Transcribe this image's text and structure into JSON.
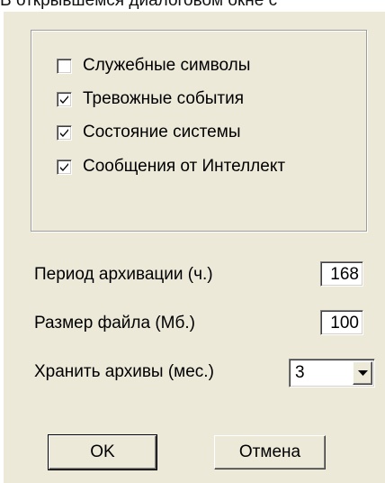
{
  "caption": "В открывшемся диалоговом окне с",
  "checkboxes": [
    {
      "label": "Служебные символы",
      "checked": false
    },
    {
      "label": "Тревожные события",
      "checked": true
    },
    {
      "label": "Состояние системы",
      "checked": true
    },
    {
      "label": "Сообщения от Интеллект",
      "checked": true
    }
  ],
  "fields": {
    "archive_period_label": "Период архивации (ч.)",
    "archive_period_value": "168",
    "file_size_label": "Размер файла (Мб.)",
    "file_size_value": "100",
    "keep_archives_label": "Хранить архивы (мес.)",
    "keep_archives_value": "3"
  },
  "buttons": {
    "ok": "OK",
    "cancel": "Отмена"
  }
}
